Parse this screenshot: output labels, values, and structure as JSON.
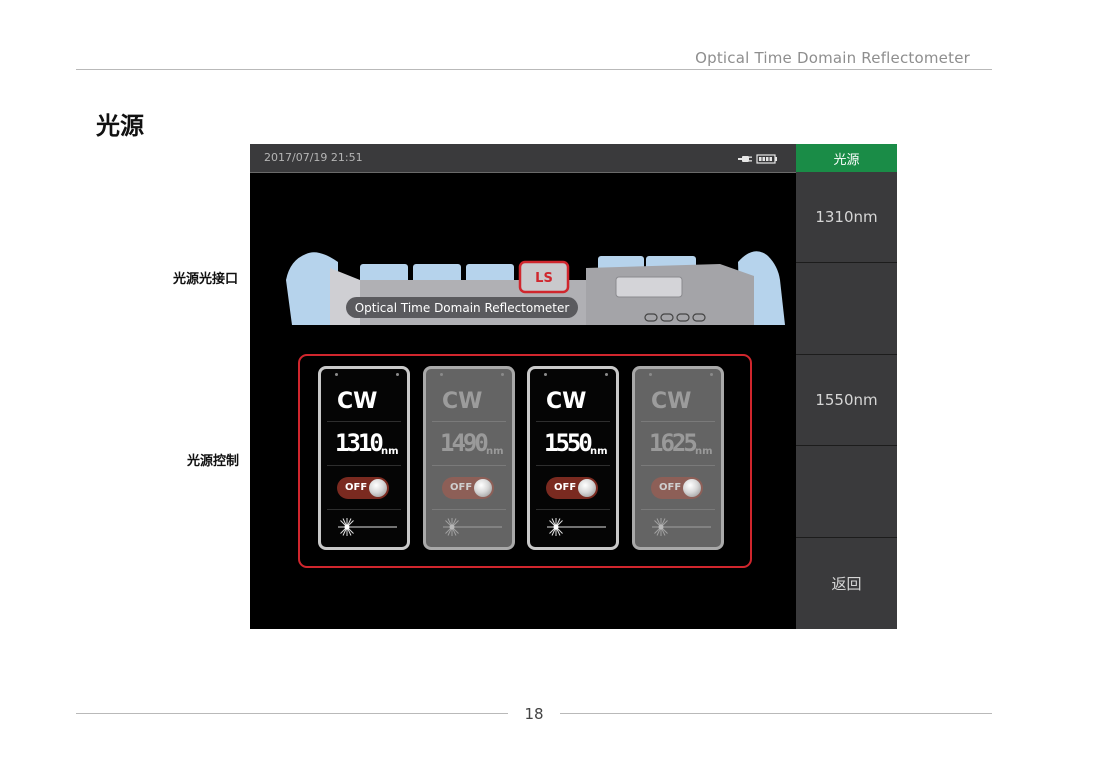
{
  "header": {
    "title": "Optical Time Domain Reflectometer"
  },
  "section": {
    "title": "光源"
  },
  "callouts": {
    "port": "光源光接口",
    "control": "光源控制"
  },
  "screen": {
    "datetime": "2017/07/19  21:51",
    "icons": [
      "plug-icon",
      "battery-icon"
    ],
    "device": {
      "label": "Optical Time Domain Reflectometer",
      "port_label": "LS"
    },
    "cards": [
      {
        "mode": "CW",
        "wavelength": "1310",
        "unit": "nm",
        "switch": "OFF",
        "enabled": true
      },
      {
        "mode": "CW",
        "wavelength": "1490",
        "unit": "nm",
        "switch": "OFF",
        "enabled": false
      },
      {
        "mode": "CW",
        "wavelength": "1550",
        "unit": "nm",
        "switch": "OFF",
        "enabled": true
      },
      {
        "mode": "CW",
        "wavelength": "1625",
        "unit": "nm",
        "switch": "OFF",
        "enabled": false
      }
    ]
  },
  "softkeys": [
    {
      "label": "光源",
      "active": true
    },
    {
      "label": "1310nm",
      "active": false
    },
    {
      "label": "",
      "active": false
    },
    {
      "label": "1550nm",
      "active": false
    },
    {
      "label": "",
      "active": false
    },
    {
      "label": "返回",
      "active": false
    }
  ],
  "footer": {
    "page": "18"
  },
  "colors": {
    "accent_red": "#d0262d",
    "active_green": "#1a8c47",
    "softkey_gray": "#3a3a3c"
  }
}
